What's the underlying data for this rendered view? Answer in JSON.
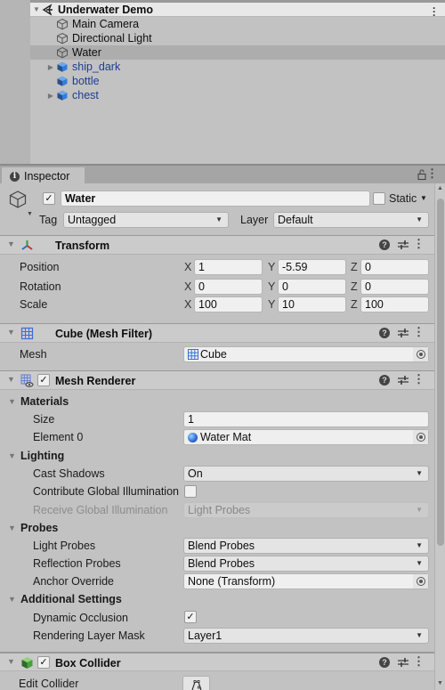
{
  "hierarchy": {
    "scene": {
      "name": "Underwater Demo",
      "icon": "unity-scene-icon",
      "expanded": true
    },
    "items": [
      {
        "name": "Main Camera",
        "icon": "gameobject-cube-icon",
        "prefab": false,
        "expandable": false,
        "selected": false
      },
      {
        "name": "Directional Light",
        "icon": "gameobject-cube-icon",
        "prefab": false,
        "expandable": false,
        "selected": false
      },
      {
        "name": "Water",
        "icon": "gameobject-cube-icon",
        "prefab": false,
        "expandable": false,
        "selected": true
      },
      {
        "name": "ship_dark",
        "icon": "prefab-icon",
        "prefab": true,
        "expandable": true,
        "selected": false
      },
      {
        "name": "bottle",
        "icon": "prefab-icon",
        "prefab": true,
        "expandable": false,
        "selected": false
      },
      {
        "name": "chest",
        "icon": "prefab-icon",
        "prefab": true,
        "expandable": true,
        "selected": false
      }
    ]
  },
  "inspector": {
    "tab_label": "Inspector",
    "gameobject": {
      "active": true,
      "name": "Water",
      "static_label": "Static",
      "static": false,
      "tag_label": "Tag",
      "tag": "Untagged",
      "layer_label": "Layer",
      "layer": "Default"
    },
    "transform": {
      "title": "Transform",
      "rows": [
        {
          "label": "Position",
          "x": "1",
          "y": "-5.59",
          "z": "0"
        },
        {
          "label": "Rotation",
          "x": "0",
          "y": "0",
          "z": "0"
        },
        {
          "label": "Scale",
          "x": "100",
          "y": "10",
          "z": "100"
        }
      ],
      "axis_labels": [
        "X",
        "Y",
        "Z"
      ]
    },
    "mesh_filter": {
      "title": "Cube (Mesh Filter)",
      "mesh_label": "Mesh",
      "mesh": "Cube"
    },
    "mesh_renderer": {
      "title": "Mesh Renderer",
      "enabled": true,
      "materials": {
        "title": "Materials",
        "size_label": "Size",
        "size": "1",
        "element0_label": "Element 0",
        "element0": "Water Mat"
      },
      "lighting": {
        "title": "Lighting",
        "cast_shadows_label": "Cast Shadows",
        "cast_shadows": "On",
        "contribute_gi_label": "Contribute Global Illumination",
        "contribute_gi": false,
        "receive_gi_label": "Receive Global Illumination",
        "receive_gi": "Light Probes"
      },
      "probes": {
        "title": "Probes",
        "light_probes_label": "Light Probes",
        "light_probes": "Blend Probes",
        "reflection_probes_label": "Reflection Probes",
        "reflection_probes": "Blend Probes",
        "anchor_override_label": "Anchor Override",
        "anchor_override": "None (Transform)"
      },
      "additional": {
        "title": "Additional Settings",
        "dynamic_occlusion_label": "Dynamic Occlusion",
        "dynamic_occlusion": true,
        "rendering_layer_mask_label": "Rendering Layer Mask",
        "rendering_layer_mask": "Layer1"
      }
    },
    "box_collider": {
      "title": "Box Collider",
      "enabled": true,
      "edit_collider_label": "Edit Collider"
    }
  },
  "colors": {
    "panel_bg": "#c2c2c2",
    "prefab_text": "#1d3e8f",
    "selection_bg": "#adadad",
    "field_bg": "#f0f0f0"
  }
}
